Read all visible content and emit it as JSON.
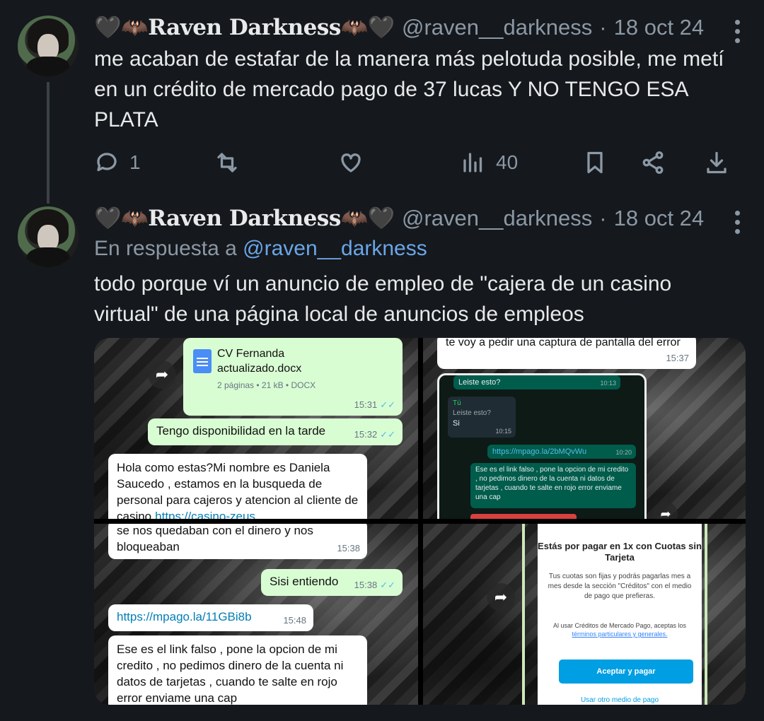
{
  "tweets": [
    {
      "display_name": "🖤🦇Raven Darkness🦇🖤",
      "handle": "@raven__darkness",
      "separator": "·",
      "date": "18 oct 24",
      "text": "me acaban de estafar de la manera más pelotuda posible, me metí en un crédito de mercado pago de 37 lucas Y NO TENGO ESA PLATA",
      "actions": {
        "reply_count": "1",
        "retweet_count": "",
        "like_count": "",
        "views_count": "40"
      }
    },
    {
      "display_name": "🖤🦇Raven Darkness🦇🖤",
      "handle": "@raven__darkness",
      "separator": "·",
      "date": "18 oct 24",
      "reply_prefix": "En respuesta a",
      "reply_handle": "@raven__darkness",
      "text": "todo porque ví un anuncio de empleo de \"cajera de un casino virtual\" de una página local de anuncios de empleos"
    }
  ],
  "media": {
    "img1": {
      "doc_name": "CV Fernanda actualizado.docx",
      "doc_meta": "2 páginas • 21 kB • DOCX",
      "doc_time": "15:31",
      "msg1": "Tengo disponibilidad en la tarde",
      "msg1_time": "15:32",
      "msg2": "Hola como estas?Mi nombre es Daniela Saucedo , estamos en la busqueda de personal para cajeros y atencion al cliente de casino",
      "msg2_link": "https://casino-zeus"
    },
    "img2": {
      "top_msg": "te voy a pedir una captura de pantalla del error",
      "top_time": "15:37",
      "p_msg1": "Leiste esto?",
      "p_msg1_time": "10:13",
      "p_quote_name": "Tú",
      "p_quote_text": "Leiste esto?",
      "p_msg2": "Si",
      "p_msg2_time": "10:15",
      "p_link": "https://mpago.la/2bMQvWu",
      "p_link_time": "10:20",
      "p_msg3": "Ese es el link falso , pone la opcion de mi credito , no pedimos dinero de la cuenta ni datos de tarjetas , cuando te salte en rojo error enviame una cap",
      "p_msg3_time": "10:20"
    },
    "img3": {
      "msg1": "se nos quedaban con el dinero y nos bloqueaban",
      "msg1_time": "15:38",
      "msg2": "Sisi entiendo",
      "msg2_time": "15:38",
      "link": "https://mpago.la/11GBi8b",
      "link_time": "15:48",
      "msg3": "Ese es el link falso , pone la opcion de mi credito , no pedimos dinero de la cuenta ni datos de tarjetas , cuando te salte en rojo error enviame una cap"
    },
    "img4": {
      "title": "Estás por pagar en 1x con Cuotas sin Tarjeta",
      "body": "Tus cuotas son fijas y podrás pagarlas mes a mes desde la sección \"Créditos\" con el medio de pago que prefieras.",
      "terms_prefix": "Al usar Créditos de Mercado Pago, aceptas los",
      "terms_link": "términos particulares y generales.",
      "button": "Aceptar y pagar",
      "other": "Usar otro medio de pago"
    }
  },
  "colors": {
    "background": "#15181c",
    "text": "#e7e9ea",
    "muted": "#8b98a5",
    "link": "#6aa6e8",
    "wa_out": "#d9fdd3",
    "wa_in": "#ffffff",
    "mp_blue": "#009ee3"
  }
}
